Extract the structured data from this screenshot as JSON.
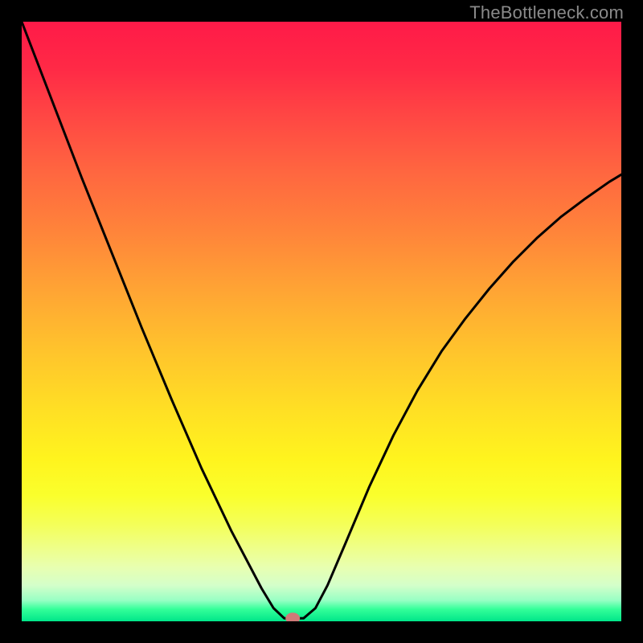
{
  "watermark": {
    "text": "TheBottleneck.com"
  },
  "chart_data": {
    "type": "line",
    "title": "",
    "xlabel": "",
    "ylabel": "",
    "xlim": [
      0,
      1
    ],
    "ylim": [
      0,
      1
    ],
    "series": [
      {
        "name": "curve",
        "x": [
          0.0,
          0.05,
          0.1,
          0.15,
          0.2,
          0.25,
          0.3,
          0.35,
          0.4,
          0.42,
          0.438,
          0.452,
          0.47,
          0.49,
          0.51,
          0.54,
          0.58,
          0.62,
          0.66,
          0.7,
          0.74,
          0.78,
          0.82,
          0.86,
          0.9,
          0.94,
          0.98,
          1.0
        ],
        "y": [
          1.0,
          0.87,
          0.74,
          0.615,
          0.49,
          0.37,
          0.255,
          0.15,
          0.055,
          0.022,
          0.005,
          0.005,
          0.005,
          0.022,
          0.06,
          0.13,
          0.225,
          0.31,
          0.385,
          0.45,
          0.505,
          0.555,
          0.6,
          0.64,
          0.675,
          0.705,
          0.733,
          0.745
        ]
      }
    ],
    "marker": {
      "x": 0.452,
      "y": 0.005,
      "color": "#cf7a78"
    },
    "gradient_stops": [
      {
        "pos": 0.0,
        "color": "#ff1a48"
      },
      {
        "pos": 0.5,
        "color": "#ffc42c"
      },
      {
        "pos": 0.8,
        "color": "#faff2c"
      },
      {
        "pos": 0.97,
        "color": "#33ff99"
      },
      {
        "pos": 1.0,
        "color": "#00e68a"
      }
    ]
  }
}
